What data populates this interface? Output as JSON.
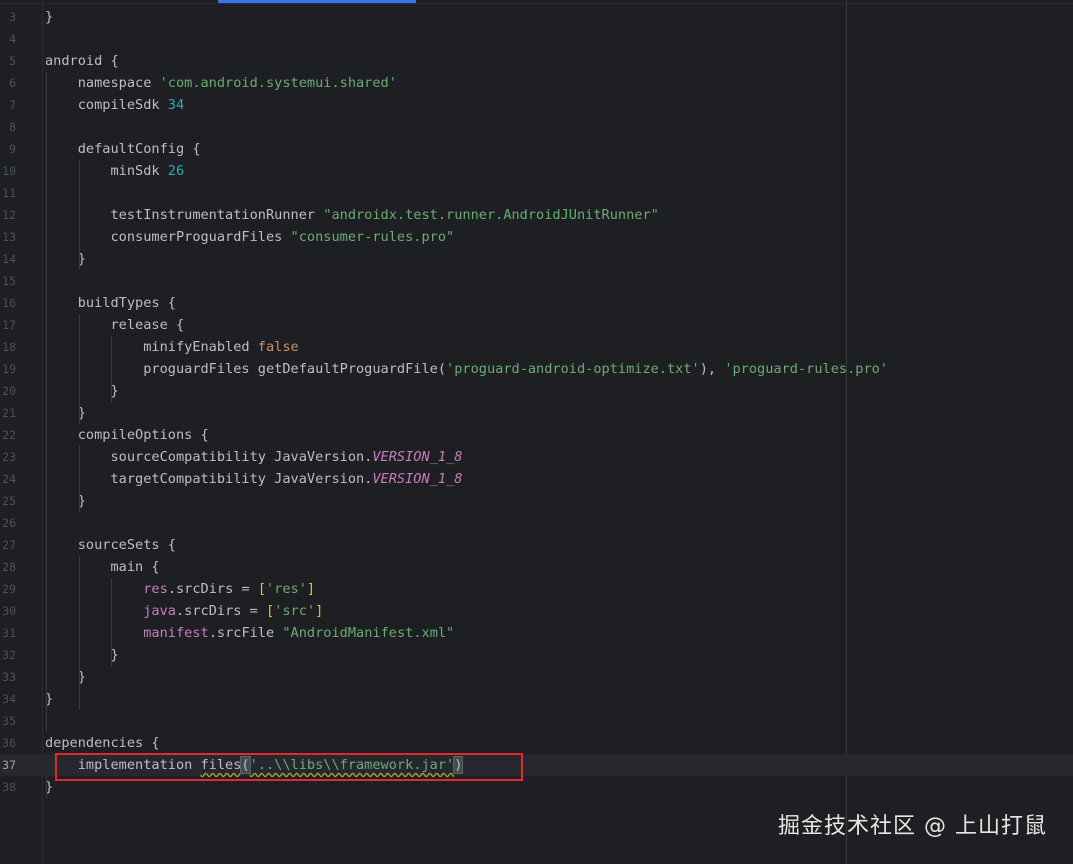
{
  "editor": {
    "current_line": 37,
    "lines": [
      {
        "n": "3",
        "text": "}"
      },
      {
        "n": "4",
        "text": ""
      },
      {
        "n": "5",
        "text": "android {"
      },
      {
        "n": "6",
        "text": "    namespace 'com.android.systemui.shared'"
      },
      {
        "n": "7",
        "text": "    compileSdk 34"
      },
      {
        "n": "8",
        "text": ""
      },
      {
        "n": "9",
        "text": "    defaultConfig {"
      },
      {
        "n": "10",
        "text": "        minSdk 26"
      },
      {
        "n": "11",
        "text": ""
      },
      {
        "n": "12",
        "text": "        testInstrumentationRunner \"androidx.test.runner.AndroidJUnitRunner\""
      },
      {
        "n": "13",
        "text": "        consumerProguardFiles \"consumer-rules.pro\""
      },
      {
        "n": "14",
        "text": "    }"
      },
      {
        "n": "15",
        "text": ""
      },
      {
        "n": "16",
        "text": "    buildTypes {"
      },
      {
        "n": "17",
        "text": "        release {"
      },
      {
        "n": "18",
        "text": "            minifyEnabled false"
      },
      {
        "n": "19",
        "text": "            proguardFiles getDefaultProguardFile('proguard-android-optimize.txt'), 'proguard-rules.pro'"
      },
      {
        "n": "20",
        "text": "        }"
      },
      {
        "n": "21",
        "text": "    }"
      },
      {
        "n": "22",
        "text": "    compileOptions {"
      },
      {
        "n": "23",
        "text": "        sourceCompatibility JavaVersion.VERSION_1_8"
      },
      {
        "n": "24",
        "text": "        targetCompatibility JavaVersion.VERSION_1_8"
      },
      {
        "n": "25",
        "text": "    }"
      },
      {
        "n": "26",
        "text": ""
      },
      {
        "n": "27",
        "text": "    sourceSets {"
      },
      {
        "n": "28",
        "text": "        main {"
      },
      {
        "n": "29",
        "text": "            res.srcDirs = ['res']"
      },
      {
        "n": "30",
        "text": "            java.srcDirs = ['src']"
      },
      {
        "n": "31",
        "text": "            manifest.srcFile \"AndroidManifest.xml\""
      },
      {
        "n": "32",
        "text": "        }"
      },
      {
        "n": "33",
        "text": "    }"
      },
      {
        "n": "34",
        "text": "}"
      },
      {
        "n": "35",
        "text": ""
      },
      {
        "n": "36",
        "text": "dependencies {"
      },
      {
        "n": "37",
        "text": "    implementation files('..\\\\libs\\\\framework.jar')"
      },
      {
        "n": "38",
        "text": "}"
      }
    ]
  },
  "highlight_box_color": "#e3282e",
  "watermark": "掘金技术社区 @ 上山打鼠"
}
